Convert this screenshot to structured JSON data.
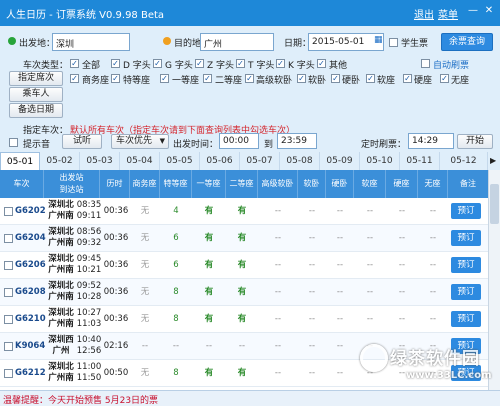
{
  "titlebar": {
    "title": "人生日历 - 订票系统 V0.9.98 Beta",
    "logout": "退出",
    "menu": "菜单"
  },
  "search": {
    "from_label": "出发地：",
    "from_value": "深圳",
    "to_label": "目的地：",
    "to_value": "广州",
    "date_label": "日期：",
    "date_value": "2015-05-01",
    "student_label": "学生票",
    "query_button": "余票查询",
    "auto_refresh_label": "自动刷票"
  },
  "filters": {
    "type_label": "车次类型：",
    "types": [
      "全部",
      "D 字头",
      "G 字头",
      "Z 字头",
      "T 字头",
      "K 字头",
      "其他"
    ],
    "seat_button": "指定席次",
    "seats": [
      "商务座",
      "特等座",
      "一等座",
      "二等座",
      "高级软卧",
      "软卧",
      "硬卧",
      "软座",
      "硬座",
      "无座"
    ],
    "passenger_button": "乘车人",
    "backup_date_button": "备选日期",
    "train_label": "指定车次：",
    "train_hint": "默认所有车次（指定车次请到下面查询列表中勾选车次）"
  },
  "options": {
    "prompt_sound": "提示音",
    "test_button": "试听",
    "priority_select": "车次优先",
    "depart_time_label": "出发时间：",
    "time_from": "00:00",
    "to_word": "到",
    "time_to": "23:59",
    "timed_refresh_label": "定时刷票：",
    "timed_value": "14:29",
    "start_button": "开始"
  },
  "date_tabs": [
    "05-01",
    "05-02",
    "05-03",
    "05-04",
    "05-05",
    "05-06",
    "05-07",
    "05-08",
    "05-09",
    "05-10",
    "05-11",
    "05-12"
  ],
  "table": {
    "headers": [
      "车次",
      "出发站\n到达站",
      "历时",
      "商务座",
      "特等座",
      "一等座",
      "二等座",
      "高级软卧",
      "软卧",
      "硬卧",
      "软座",
      "硬座",
      "无座",
      "备注"
    ],
    "book_label": "预订",
    "rows": [
      {
        "code": "G6202",
        "from": "深圳北",
        "to": "广州南",
        "dep": "08:35",
        "arr": "09:11",
        "dur": "00:36",
        "swz": "无",
        "tdz": "4",
        "ydz": "有",
        "edz": "有"
      },
      {
        "code": "G6204",
        "from": "深圳北",
        "to": "广州南",
        "dep": "08:56",
        "arr": "09:32",
        "dur": "00:36",
        "swz": "无",
        "tdz": "6",
        "ydz": "有",
        "edz": "有"
      },
      {
        "code": "G6206",
        "from": "深圳北",
        "to": "广州南",
        "dep": "09:45",
        "arr": "10:21",
        "dur": "00:36",
        "swz": "无",
        "tdz": "6",
        "ydz": "有",
        "edz": "有"
      },
      {
        "code": "G6208",
        "from": "深圳北",
        "to": "广州南",
        "dep": "09:52",
        "arr": "10:28",
        "dur": "00:36",
        "swz": "无",
        "tdz": "8",
        "ydz": "有",
        "edz": "有"
      },
      {
        "code": "G6210",
        "from": "深圳北",
        "to": "广州南",
        "dep": "10:27",
        "arr": "11:03",
        "dur": "00:36",
        "swz": "无",
        "tdz": "8",
        "ydz": "有",
        "edz": "有"
      },
      {
        "code": "K9064",
        "from": "深圳西",
        "to": "广州",
        "dep": "10:40",
        "arr": "12:56",
        "dur": "02:16",
        "swz": "--",
        "tdz": "--",
        "ydz": "--",
        "edz": "--"
      },
      {
        "code": "G6212",
        "from": "深圳北",
        "to": "广州南",
        "dep": "11:00",
        "arr": "11:50",
        "dur": "00:50",
        "swz": "无",
        "tdz": "8",
        "ydz": "有",
        "edz": "有"
      }
    ]
  },
  "statusbar": {
    "message": "温馨提醒：今天开始预售 5月23日的票"
  },
  "watermark": {
    "brand": "绿茶软件园",
    "url": "www.33LC.com"
  },
  "colors": {
    "accent": "#1e88d8",
    "button": "#2d8ae0",
    "warning": "#c8102e",
    "available": "#2a8a2a"
  }
}
